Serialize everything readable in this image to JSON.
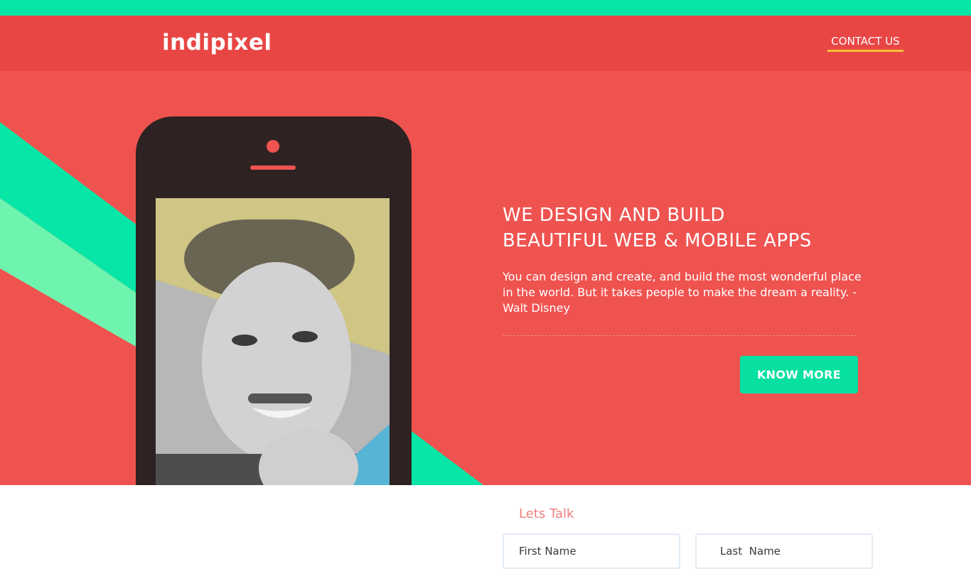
{
  "brand": {
    "logo": "indipixel"
  },
  "nav": {
    "contact_label": "CONTACT US"
  },
  "hero": {
    "headline_line1": "WE DESIGN AND BUILD",
    "headline_line2": "BEAUTIFUL WEB & MOBILE APPS",
    "quote": "You can design and create, and build the most wonderful place in the world. But it takes people to make the dream a reality. - Walt Disney",
    "cta_label": "KNOW MORE"
  },
  "contact_form": {
    "title": "Lets Talk",
    "first_name_placeholder": "First Name",
    "last_name_placeholder": "Last  Name"
  },
  "colors": {
    "top_strip": "#07e6a6",
    "navbar": "#e84645",
    "hero_background": "#ef5350",
    "accent_green": "#07e0a0",
    "accent_light_green": "#6ff4b0",
    "nav_underline": "#f5c331",
    "phone_body": "#2e2222",
    "form_title": "#f08080"
  }
}
